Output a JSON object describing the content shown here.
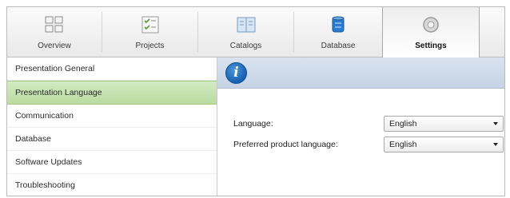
{
  "tabs": [
    {
      "label": "Overview",
      "icon": "overview-grid-icon"
    },
    {
      "label": "Projects",
      "icon": "projects-checklist-icon"
    },
    {
      "label": "Catalogs",
      "icon": "catalogs-book-icon"
    },
    {
      "label": "Database",
      "icon": "database-cylinder-icon"
    },
    {
      "label": "Settings",
      "icon": "settings-gear-icon",
      "active": true
    }
  ],
  "sidebar": {
    "items": [
      {
        "label": "Presentation General"
      },
      {
        "label": "Presentation Language",
        "selected": true
      },
      {
        "label": "Communication"
      },
      {
        "label": "Database"
      },
      {
        "label": "Software Updates"
      },
      {
        "label": "Troubleshooting"
      }
    ]
  },
  "content": {
    "info_icon": "i",
    "language": {
      "label": "Language:",
      "value": "English"
    },
    "preferred": {
      "label": "Preferred product language:",
      "value": "English"
    }
  },
  "colors": {
    "selected_item": "#c3e0ae",
    "info_bar": "#cfdbea",
    "info_icon": "#1a6cc4",
    "database_icon": "#2a7ad0"
  }
}
